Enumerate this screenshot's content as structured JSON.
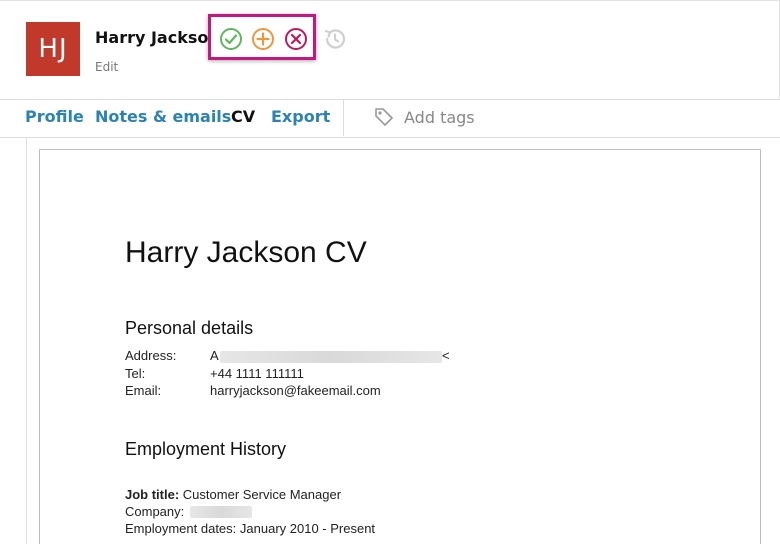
{
  "header": {
    "avatar_initials": "HJ",
    "avatar_color": "#c0392b",
    "candidate_name": "Harry Jackson",
    "edit_label": "Edit",
    "highlight_color": "#c4177f",
    "actions": [
      {
        "icon": "check-circle-icon",
        "color": "#5cb85c"
      },
      {
        "icon": "plus-circle-icon",
        "color": "#f0963b"
      },
      {
        "icon": "x-circle-icon",
        "color": "#c2185b"
      }
    ],
    "history_icon": "history-icon"
  },
  "tabs": [
    {
      "label": "Profile",
      "active": false
    },
    {
      "label": "Notes & emails",
      "active": false
    },
    {
      "label": "CV",
      "active": true
    },
    {
      "label": "Export",
      "active": false
    }
  ],
  "tags": {
    "icon": "tag-icon",
    "placeholder": "Add tags"
  },
  "cv": {
    "title": "Harry Jackson CV",
    "personal_heading": "Personal details",
    "address_label": "Address:",
    "address_value": "A",
    "address_tail": "<",
    "tel_label": "Tel:",
    "tel_value": "+44 1111 111111",
    "email_label": "Email:",
    "email_value": "harryjackson@fakeemail.com",
    "employment_heading": "Employment History",
    "job_title_label": "Job title:",
    "job_title_value": "Customer Service Manager",
    "company_label": "Company:",
    "dates_label": "Employment dates:",
    "dates_value": "January 2010 - Present"
  },
  "colors": {
    "link": "#2b82b4",
    "active_tab": "#111111"
  }
}
